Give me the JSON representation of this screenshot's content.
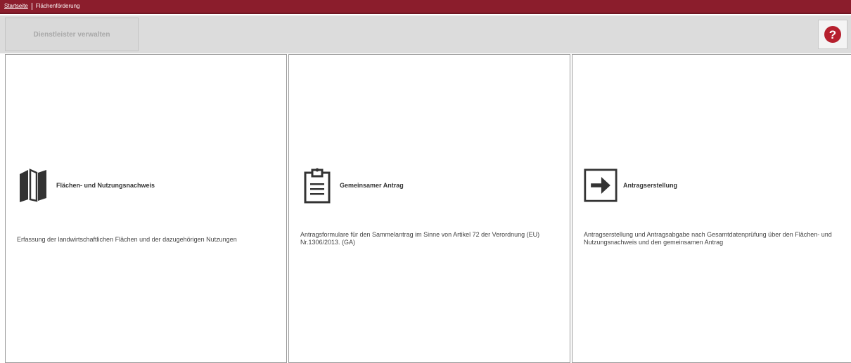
{
  "breadcrumb": {
    "home_label": "Startseite",
    "current_label": "Flächenförderung"
  },
  "toolbar": {
    "manage_providers_label": "Dienstleister verwalten",
    "help_label": "?"
  },
  "colors": {
    "brand_bar": "#8b1d2c",
    "help_icon": "#b6202e",
    "toolbar_bg": "#dcdcdc"
  },
  "tiles": [
    {
      "icon": "map-icon",
      "title": "Flächen- und Nutzungsnachweis",
      "description": "Erfassung der landwirtschaftlichen Flächen und der dazugehörigen Nutzungen"
    },
    {
      "icon": "clipboard-icon",
      "title": "Gemeinsamer Antrag",
      "description": "Antragsformulare für den Sammelantrag im Sinne von Artikel 72 der Verordnung (EU) Nr.1306/2013. (GA)"
    },
    {
      "icon": "arrow-right-box-icon",
      "title": "Antragserstellung",
      "description": "Antragserstellung und Antragsabgabe nach Gesamtdatenprüfung über den Flächen- und Nutzungsnachweis und den gemeinsamen Antrag"
    }
  ]
}
